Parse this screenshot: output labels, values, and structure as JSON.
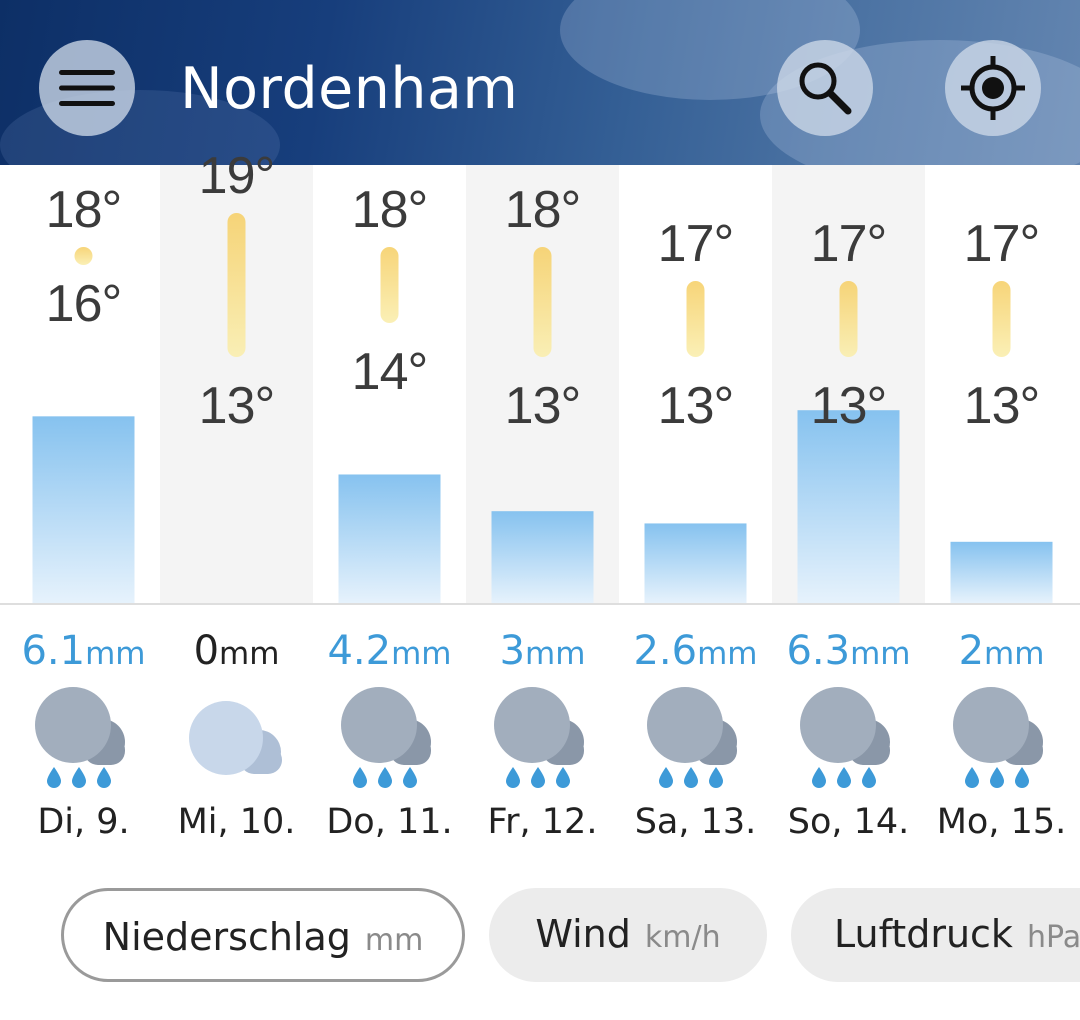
{
  "header": {
    "city": "Nordenham",
    "menu_icon": "hamburger-menu-icon",
    "search_icon": "search-icon",
    "location_icon": "locate-icon"
  },
  "colors": {
    "header": "#173e7c",
    "precip_bar_top": "#86c2ef",
    "precip_bar_bottom": "#e6f2fc",
    "temp_bar": "#f7d875",
    "precip_text": "#3d9ad8",
    "column_alt_bg": "#f4f4f4",
    "icon_cloud": "#a2aebd"
  },
  "chart_data": {
    "type": "bar",
    "categories": [
      "Di, 9.",
      "Mi, 10.",
      "Do, 11.",
      "Fr, 12.",
      "Sa, 13.",
      "So, 14.",
      "Mo, 15."
    ],
    "series": [
      {
        "values": [
          6.1,
          0,
          4.2,
          3,
          2.6,
          6.3,
          2
        ]
      },
      {
        "values": [
          18,
          19,
          18,
          18,
          17,
          17,
          17
        ]
      },
      {
        "values": [
          16,
          13,
          14,
          13,
          13,
          13,
          13
        ]
      }
    ]
  },
  "days": [
    {
      "date": "Di, 9.",
      "max": "18°",
      "min": "16°",
      "precip_value": "6.1",
      "precip_unit": "mm",
      "icon": "cloud-rain-icon"
    },
    {
      "date": "Mi, 10.",
      "max": "19°",
      "min": "13°",
      "precip_value": "0",
      "precip_unit": "mm",
      "icon": "cloud-icon"
    },
    {
      "date": "Do, 11.",
      "max": "18°",
      "min": "14°",
      "precip_value": "4.2",
      "precip_unit": "mm",
      "icon": "cloud-rain-icon"
    },
    {
      "date": "Fr, 12.",
      "max": "18°",
      "min": "13°",
      "precip_value": "3",
      "precip_unit": "mm",
      "icon": "cloud-rain-icon"
    },
    {
      "date": "Sa, 13.",
      "max": "17°",
      "min": "13°",
      "precip_value": "2.6",
      "precip_unit": "mm",
      "icon": "cloud-rain-icon"
    },
    {
      "date": "So, 14.",
      "max": "17°",
      "min": "13°",
      "precip_value": "6.3",
      "precip_unit": "mm",
      "icon": "cloud-rain-icon"
    },
    {
      "date": "Mo, 15.",
      "max": "17°",
      "min": "13°",
      "precip_value": "2",
      "precip_unit": "mm",
      "icon": "cloud-rain-icon"
    }
  ],
  "pills": [
    {
      "label": "Niederschlag",
      "unit": "mm",
      "active": true
    },
    {
      "label": "Wind",
      "unit": "km/h",
      "active": false
    },
    {
      "label": "Luftdruck",
      "unit": "hPa",
      "active": false
    }
  ]
}
